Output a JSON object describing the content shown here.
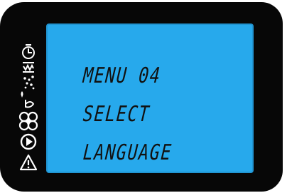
{
  "display": {
    "lines": [
      "MENU 04",
      "SELECT",
      "LANGUAGE"
    ]
  },
  "icons": [
    "clock-icon",
    "heating-icon",
    "sparkle-icon",
    "steam-icon",
    "fan-icon",
    "play-icon",
    "warning-icon"
  ],
  "colors": {
    "frame": "#070707",
    "lcd_background": "#27a9ec",
    "lcd_text": "#111111",
    "icon": "#ffffff"
  }
}
